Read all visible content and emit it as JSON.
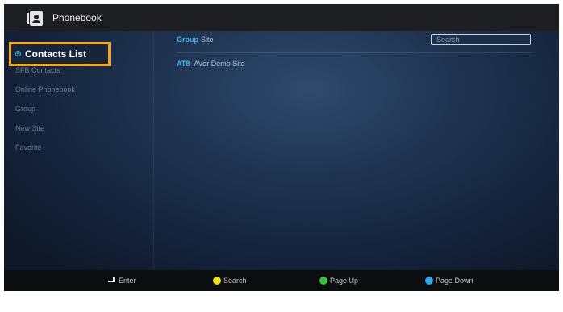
{
  "app": {
    "title": "Phonebook"
  },
  "sidebar": {
    "selected": "Contacts List",
    "items": [
      {
        "label": "SFB Contacts"
      },
      {
        "label": "Online Phonebook"
      },
      {
        "label": "Group"
      },
      {
        "label": "New Site"
      },
      {
        "label": "Favorite"
      }
    ]
  },
  "main": {
    "breadcrumb_group": "Group",
    "breadcrumb_rest": "-Site",
    "search_placeholder": "Search",
    "entries": [
      {
        "code": "AT8",
        "name": "- AVer Demo Site"
      }
    ]
  },
  "footer": {
    "hints": [
      {
        "label": "Enter",
        "key": "enter-icon"
      },
      {
        "label": "Search",
        "color": "#f0e020"
      },
      {
        "label": "Page Up",
        "color": "#38c040"
      },
      {
        "label": "Page Down",
        "color": "#30a8e8"
      }
    ]
  },
  "colors": {
    "accent": "#3fb8f0",
    "focus": "#f5a623",
    "titlebar": "#1d1e22"
  }
}
